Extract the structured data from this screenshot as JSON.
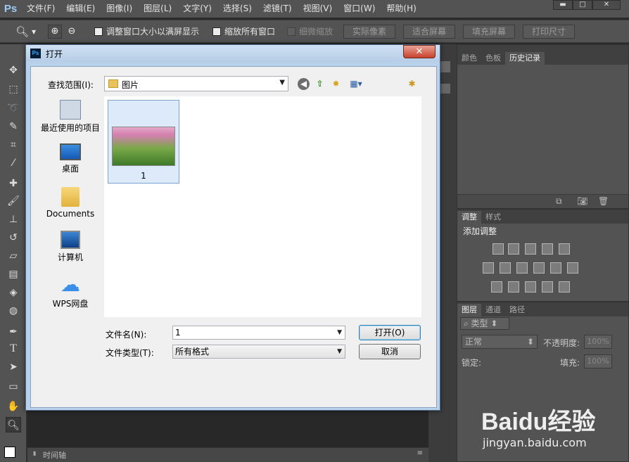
{
  "app": {
    "logo": "Ps"
  },
  "menu": [
    "文件(F)",
    "编辑(E)",
    "图像(I)",
    "图层(L)",
    "文字(Y)",
    "选择(S)",
    "滤镜(T)",
    "视图(V)",
    "窗口(W)",
    "帮助(H)"
  ],
  "window_controls": {
    "minimize": "▬",
    "maximize": "□",
    "close": "✕"
  },
  "options": {
    "resize_windows": "调整窗口大小以满屏显示",
    "zoom_all": "缩放所有窗口",
    "scrubby_zoom": "细微缩放",
    "actual_pixels": "实际像素",
    "fit_screen": "适合屏幕",
    "fill_screen": "填充屏幕",
    "print_size": "打印尺寸"
  },
  "panels": {
    "history_tabs": [
      "颜色",
      "色板",
      "历史记录"
    ],
    "adjust_tabs": [
      "调整",
      "样式"
    ],
    "adjust_title": "添加调整",
    "layers_tabs": [
      "图层",
      "通道",
      "路径"
    ],
    "layers_filter": "类型",
    "blend_mode": "正常",
    "opacity_label": "不透明度:",
    "opacity_value": "100%",
    "lock_label": "锁定:",
    "fill_label": "填充:",
    "fill_value": "100%",
    "timeline": "时间轴"
  },
  "dialog": {
    "title": "打开",
    "look_in_label": "查找范围(I):",
    "look_in_value": "图片",
    "places": [
      "最近使用的项目",
      "桌面",
      "Documents",
      "计算机",
      "WPS网盘"
    ],
    "file": {
      "name": "1"
    },
    "filename_label": "文件名(N):",
    "filename_value": "1",
    "filetype_label": "文件类型(T):",
    "filetype_value": "所有格式",
    "open_button": "打开(O)",
    "cancel_button": "取消"
  },
  "watermark": {
    "brand": "Baidu经验",
    "url": "jingyan.baidu.com"
  }
}
